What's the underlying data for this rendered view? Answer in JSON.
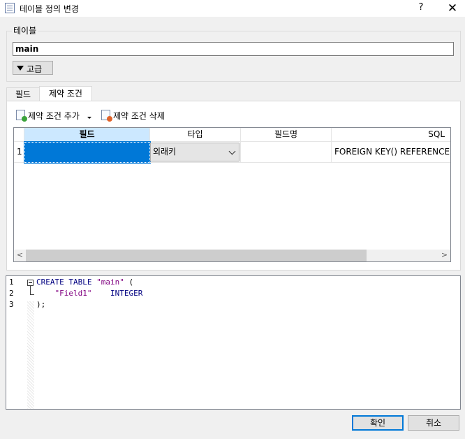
{
  "window": {
    "title": "테이블 정의 변경",
    "help_label": "?",
    "close_label": "✕"
  },
  "table_group": {
    "legend": "테이블",
    "name_value": "main",
    "advanced_label": "고급"
  },
  "tabs": [
    {
      "label": "필드"
    },
    {
      "label": "제약 조건"
    }
  ],
  "toolbar": {
    "add_label": "제약 조건 추가",
    "delete_label": "제약 조건 삭제"
  },
  "grid": {
    "columns": [
      "필드",
      "타입",
      "필드명",
      "SQL"
    ],
    "rows": [
      {
        "num": "1",
        "field": "",
        "type": "외래키",
        "name": "",
        "sql": "FOREIGN KEY() REFERENCES"
      }
    ],
    "scroll_left": "<",
    "scroll_right": ">"
  },
  "editor": {
    "line_numbers": [
      "1",
      "2",
      "3"
    ],
    "lines": [
      {
        "kw1": "CREATE TABLE",
        "str": "\"main\"",
        "rest": " ("
      },
      {
        "indent": "    ",
        "str": "\"Field1\"",
        "kw1": "INTEGER"
      },
      {
        "punc": ");"
      }
    ]
  },
  "buttons": {
    "ok": "확인",
    "cancel": "취소"
  }
}
